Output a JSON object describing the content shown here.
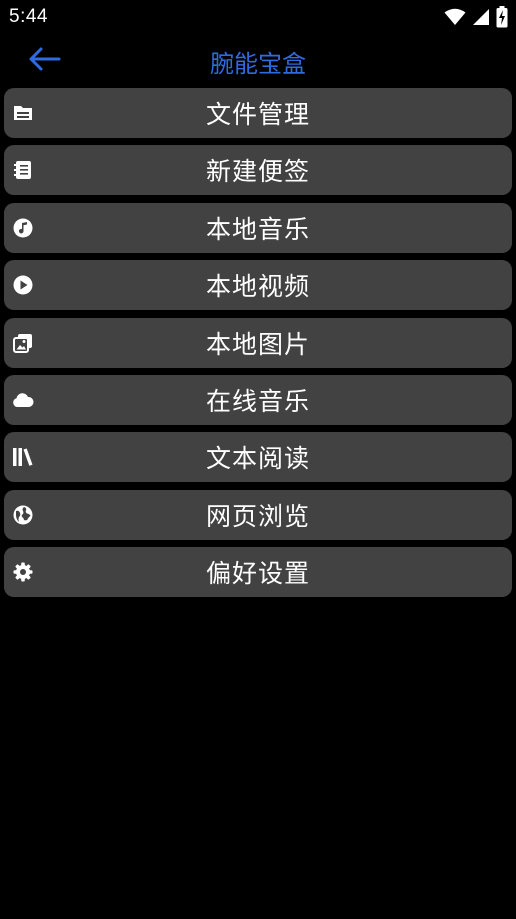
{
  "status_bar": {
    "time": "5:44",
    "icons": [
      "wifi-icon",
      "cell-signal-icon",
      "battery-charging-icon"
    ]
  },
  "app_bar": {
    "title": "腕能宝盒",
    "back_icon": "arrow-left-icon",
    "accent_color": "#2f6be0"
  },
  "menu": {
    "items": [
      {
        "label": "文件管理",
        "icon": "file-icon"
      },
      {
        "label": "新建便签",
        "icon": "note-icon"
      },
      {
        "label": "本地音乐",
        "icon": "music-icon"
      },
      {
        "label": "本地视频",
        "icon": "play-icon"
      },
      {
        "label": "本地图片",
        "icon": "image-icon"
      },
      {
        "label": "在线音乐",
        "icon": "cloud-icon"
      },
      {
        "label": "文本阅读",
        "icon": "library-icon"
      },
      {
        "label": "网页浏览",
        "icon": "globe-icon"
      },
      {
        "label": "偏好设置",
        "icon": "gear-icon"
      }
    ],
    "item_color": "#424242"
  },
  "colors": {
    "background": "#000000",
    "text": "#ffffff"
  }
}
